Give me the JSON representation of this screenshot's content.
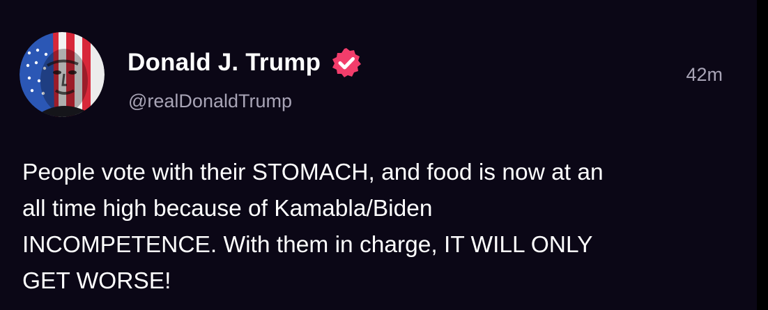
{
  "post": {
    "author": {
      "display_name": "Donald J. Trump",
      "handle": "@realDonaldTrump",
      "verified": true,
      "avatar_icon": "avatar-image"
    },
    "timestamp": "42m",
    "body_lines": [
      "People vote with their STOMACH, and food is now at an",
      "all time high because of Kamabla/Biden",
      "INCOMPETENCE. With them in charge, IT WILL ONLY",
      "GET WORSE!"
    ]
  },
  "colors": {
    "background": "#0b0716",
    "text": "#ffffff",
    "muted_text": "#a8a4b6",
    "verified_badge": "#f23d6b"
  }
}
